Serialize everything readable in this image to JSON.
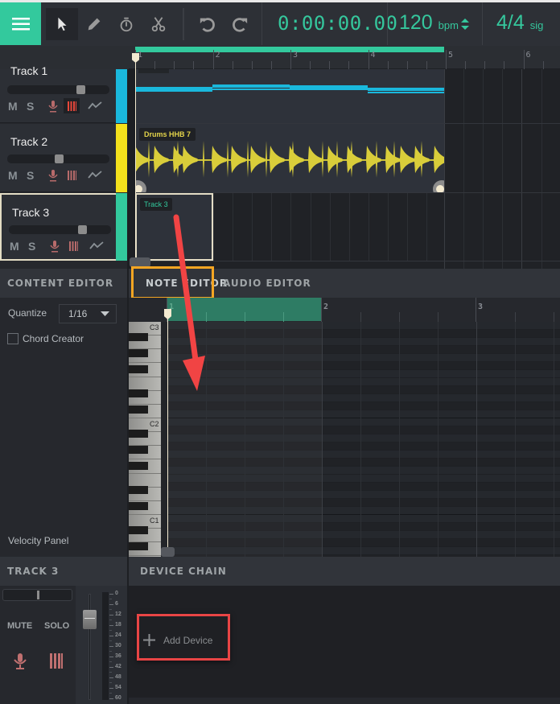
{
  "toolbar": {
    "menu_icon": "hamburger-icon",
    "tools": [
      {
        "name": "select-tool",
        "icon": "cursor-arrow-icon",
        "active": true
      },
      {
        "name": "pencil-tool",
        "icon": "pencil-icon",
        "active": false
      },
      {
        "name": "metronome-tool",
        "icon": "stopwatch-icon",
        "active": false
      },
      {
        "name": "cut-tool",
        "icon": "scissors-icon",
        "active": false
      }
    ],
    "undo_icon": "undo-icon",
    "redo_icon": "redo-icon",
    "time": "0:00:00.00",
    "bpm": "120",
    "bpm_unit": "bpm",
    "sig": "4/4",
    "sig_unit": "sig"
  },
  "timeline": {
    "bars": [
      "1",
      "2",
      "3",
      "4",
      "5",
      "6"
    ]
  },
  "tracks": [
    {
      "name": "Track 1",
      "color": "#1ab8dc",
      "volume": 0.72,
      "mute": "M",
      "solo": "S",
      "instrument_active": true
    },
    {
      "name": "Track 2",
      "color": "#f4e11c",
      "volume": 0.5,
      "mute": "M",
      "solo": "S",
      "instrument_active": false
    },
    {
      "name": "Track 3",
      "color": "#33c99d",
      "volume": 0.72,
      "mute": "M",
      "solo": "S",
      "instrument_active": false,
      "selected": true
    }
  ],
  "clips": {
    "track2_clip": "Drums HHB 7",
    "track3_clip": "Track 3"
  },
  "content_editor": {
    "title": "CONTENT EDITOR",
    "quantize_label": "Quantize",
    "quantize_value": "1/16",
    "chord_creator": "Chord Creator",
    "velocity_panel": "Velocity Panel"
  },
  "editor_tabs": [
    {
      "label": "NOTE EDITOR",
      "active": true
    },
    {
      "label": "AUDIO EDITOR",
      "active": false
    }
  ],
  "piano_roll": {
    "bars": [
      "1",
      "2",
      "3"
    ],
    "octave_labels": [
      "C3",
      "C2",
      "C1"
    ]
  },
  "track_panel": {
    "title": "TRACK 3",
    "mute": "MUTE",
    "solo": "SOLO",
    "pan": 0.5,
    "fader_db_scale": [
      "0",
      "6",
      "12",
      "18",
      "24",
      "30",
      "36",
      "42",
      "48",
      "54",
      "60"
    ]
  },
  "device_chain": {
    "title": "DEVICE CHAIN",
    "add_device": "Add Device"
  },
  "annotations": {
    "highlight_color_tab": "#f5a623",
    "highlight_color_device": "#e94545",
    "arrow_color": "#f14444"
  }
}
